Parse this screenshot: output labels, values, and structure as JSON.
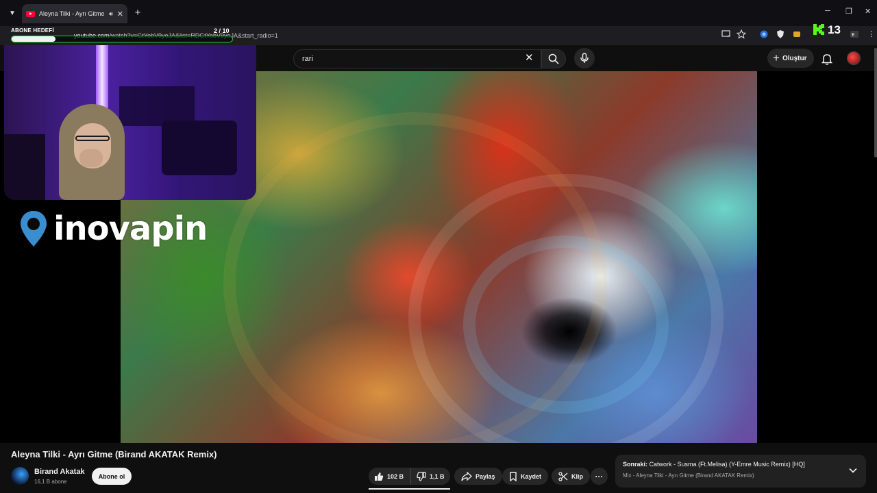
{
  "browser": {
    "tab_title": "Aleyna Tilki - Ayrı Gitme (Bi",
    "url_host": "youtube.com",
    "url_path": "/watch?v=GtYobV9yoJA&list=RDGtYobV9yoJA&start_radio=1"
  },
  "overlay": {
    "goal_label": "ABONE HEDEFİ",
    "goal_count": "2 / 10",
    "goal_progress": 0.2,
    "kick_count": "13",
    "sponsor": "inovapin"
  },
  "masthead": {
    "search_value": "rari",
    "create_label": "Oluştur"
  },
  "video": {
    "title": "Aleyna Tilki - Ayrı Gitme (Birand AKATAK Remix)",
    "channel_name": "Birand Akatak",
    "channel_subs": "16,1 B abone",
    "subscribe_label": "Abone ol",
    "likes": "102 B",
    "dislikes": "1,1 B",
    "share_label": "Paylaş",
    "save_label": "Kaydet",
    "clip_label": "Klip"
  },
  "up_next": {
    "prefix": "Sonraki:",
    "title": "Catwork - Susma (Ft.Melisa) (Y-Emre Music Remix) [HQ]",
    "subtitle": "Mix - Aleyna Tilki - Ayrı Gitme (Birand AKATAK Remix)"
  },
  "colors": {
    "background": "#0f0f0f",
    "goal_border": "#21d24c",
    "youtube_red": "#ff0033"
  }
}
